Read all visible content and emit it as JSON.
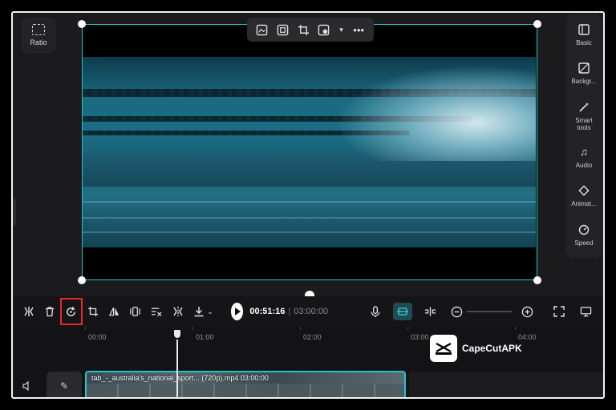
{
  "preview": {
    "ratio_label": "Ratio"
  },
  "floating_toolbar": {
    "items": [
      "ai-image-icon",
      "fit-icon",
      "crop-icon",
      "mask-icon",
      "more-icon"
    ]
  },
  "sidebar": {
    "items": [
      {
        "label": "Basic",
        "icon": "basic-icon"
      },
      {
        "label": "Backgr...",
        "icon": "background-icon"
      },
      {
        "label": "Smart tools",
        "icon": "smart-tools-icon"
      },
      {
        "label": "Audio",
        "icon": "audio-icon"
      },
      {
        "label": "Animat...",
        "icon": "animation-icon"
      },
      {
        "label": "Speed",
        "icon": "speed-icon"
      }
    ]
  },
  "toolbar": {
    "current_time": "00:51:16",
    "separator": "|",
    "total_time": "03:00:00"
  },
  "timeline": {
    "ticks": [
      "00:00",
      "01:00",
      "02:00",
      "03:00",
      "04:00"
    ],
    "clip_label": "tab_-_australia's_national_sport... (720p).mp4   03:00:00"
  },
  "watermark": {
    "text": "CapeCutAPK"
  },
  "colors": {
    "accent": "#22c3cf",
    "highlight": "#e8262b"
  }
}
